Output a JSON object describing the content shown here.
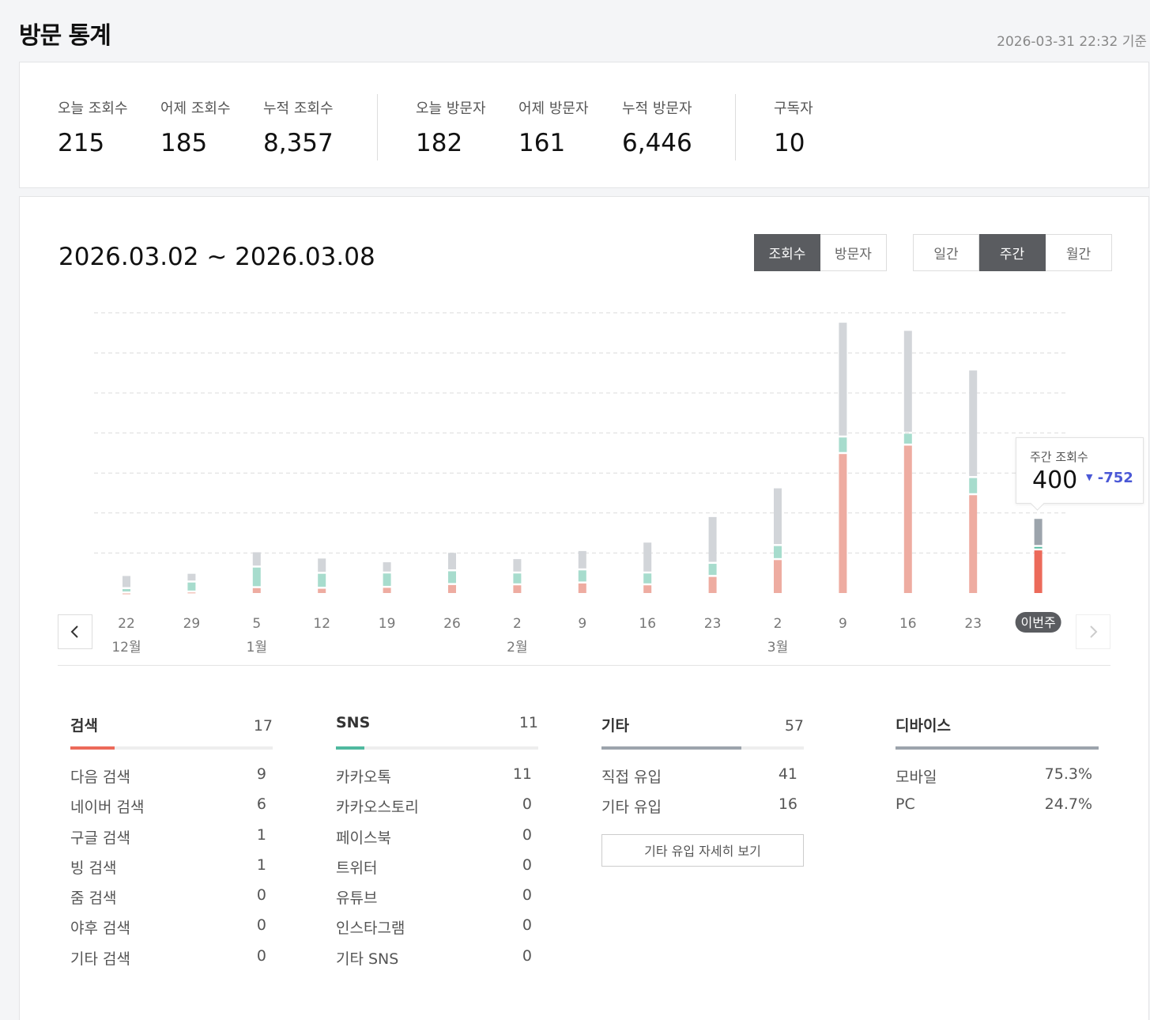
{
  "header": {
    "title": "방문 통계",
    "timestamp": "2026-03-31 22:32 기준"
  },
  "summary": [
    {
      "label": "오늘 조회수",
      "value": "215"
    },
    {
      "label": "어제 조회수",
      "value": "185"
    },
    {
      "label": "누적 조회수",
      "value": "8,357"
    },
    {
      "label": "오늘 방문자",
      "value": "182"
    },
    {
      "label": "어제 방문자",
      "value": "161"
    },
    {
      "label": "누적 방문자",
      "value": "6,446"
    },
    {
      "label": "구독자",
      "value": "10"
    }
  ],
  "period": {
    "range": "2026.03.02 ~ 2026.03.08"
  },
  "toggles": {
    "metric": [
      "조회수",
      "방문자"
    ],
    "metric_active": "조회수",
    "interval": [
      "일간",
      "주간",
      "월간"
    ],
    "interval_active": "주간"
  },
  "colors": {
    "search": "#ec6a5a",
    "sns": "#4fb99f",
    "other": "#9ca4ac",
    "accent": "#4a58d6"
  },
  "chart_data": {
    "type": "bar",
    "stacked": true,
    "categories": [
      "22",
      "29",
      "5",
      "12",
      "19",
      "26",
      "2",
      "9",
      "16",
      "23",
      "2",
      "9",
      "16",
      "23",
      "이번주"
    ],
    "month_labels": [
      "12월",
      "",
      "1월",
      "",
      "",
      "",
      "2월",
      "",
      "",
      "",
      "3월",
      "",
      "",
      "",
      ""
    ],
    "current_label": "이번주",
    "series": [
      {
        "key": "search",
        "values": [
          5,
          8,
          22,
          20,
          23,
          32,
          31,
          37,
          31,
          58,
          112,
          452,
          479,
          320,
          143
        ]
      },
      {
        "key": "sns",
        "values": [
          14,
          32,
          66,
          48,
          46,
          44,
          38,
          42,
          38,
          42,
          45,
          53,
          38,
          55,
          11
        ]
      },
      {
        "key": "other",
        "values": [
          42,
          28,
          49,
          49,
          36,
          59,
          46,
          62,
          99,
          150,
          185,
          368,
          330,
          345,
          90
        ]
      }
    ],
    "ylim": [
      0,
      900
    ],
    "grid": true,
    "tooltip": {
      "label": "주간 조회수",
      "value": "400",
      "delta": "-752"
    }
  },
  "breakdown": {
    "search": {
      "title": "검색",
      "total": "17",
      "share": 0.22,
      "items": [
        {
          "label": "다음 검색",
          "value": "9"
        },
        {
          "label": "네이버 검색",
          "value": "6"
        },
        {
          "label": "구글 검색",
          "value": "1"
        },
        {
          "label": "빙 검색",
          "value": "1"
        },
        {
          "label": "줌 검색",
          "value": "0"
        },
        {
          "label": "야후 검색",
          "value": "0"
        },
        {
          "label": "기타 검색",
          "value": "0"
        }
      ]
    },
    "sns": {
      "title": "SNS",
      "total": "11",
      "share": 0.14,
      "items": [
        {
          "label": "카카오톡",
          "value": "11"
        },
        {
          "label": "카카오스토리",
          "value": "0"
        },
        {
          "label": "페이스북",
          "value": "0"
        },
        {
          "label": "트위터",
          "value": "0"
        },
        {
          "label": "유튜브",
          "value": "0"
        },
        {
          "label": "인스타그램",
          "value": "0"
        },
        {
          "label": "기타 SNS",
          "value": "0"
        }
      ]
    },
    "other": {
      "title": "기타",
      "total": "57",
      "share": 0.69,
      "items": [
        {
          "label": "직접 유입",
          "value": "41"
        },
        {
          "label": "기타 유입",
          "value": "16"
        }
      ],
      "detail_button": "기타 유입 자세히 보기"
    },
    "device": {
      "title": "디바이스",
      "share": 1.0,
      "items": [
        {
          "label": "모바일",
          "value": "75.3%"
        },
        {
          "label": "PC",
          "value": "24.7%"
        }
      ]
    }
  }
}
